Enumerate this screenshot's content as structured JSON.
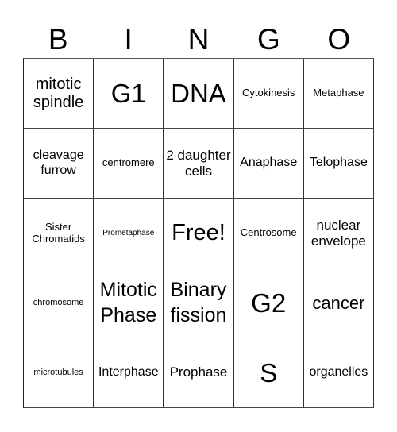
{
  "header": [
    "B",
    "I",
    "N",
    "G",
    "O"
  ],
  "rows": [
    [
      "mitotic spindle",
      "G1",
      "DNA",
      "Cytokinesis",
      "Metaphase"
    ],
    [
      "cleavage furrow",
      "centromere",
      "2 daughter cells",
      "Anaphase",
      "Telophase"
    ],
    [
      "Sister Chromatids",
      "Prometaphase",
      "Free!",
      "Centrosome",
      "nuclear envelope"
    ],
    [
      "chromosome",
      "Mitotic Phase",
      "Binary fission",
      "G2",
      "cancer"
    ],
    [
      "microtubules",
      "Interphase",
      "Prophase",
      "S",
      "organelles"
    ]
  ]
}
